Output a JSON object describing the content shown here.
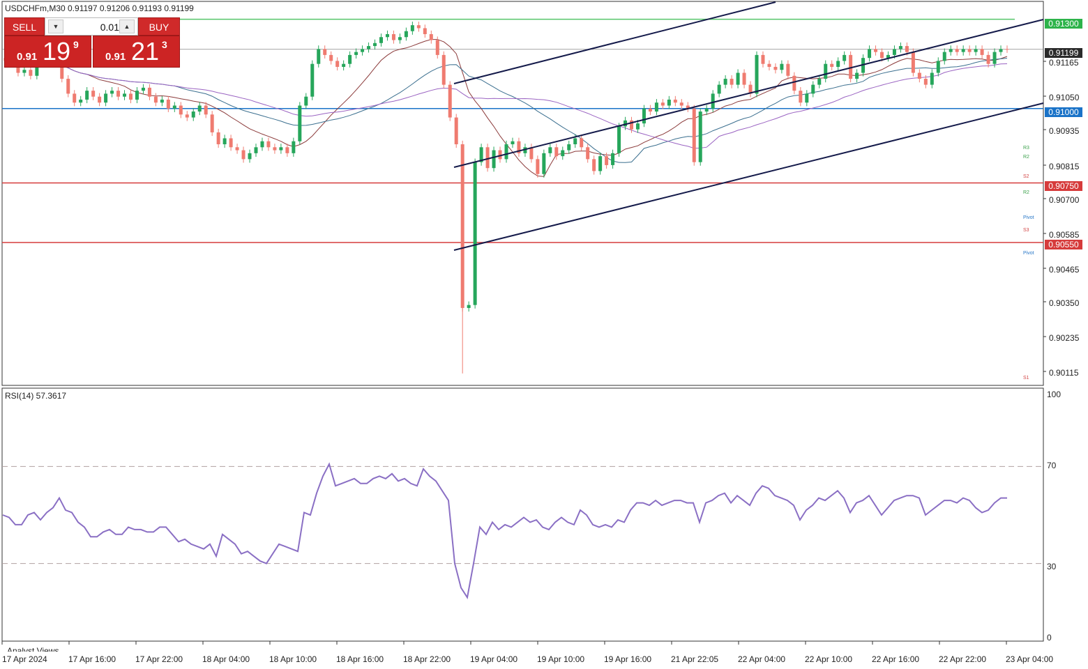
{
  "header": {
    "symbol_info": "USDCHFm,M30  0.91197 0.91206 0.91193 0.91199"
  },
  "trade_panel": {
    "sell_label": "SELL",
    "buy_label": "BUY",
    "lot_value": "0.01",
    "bid": {
      "prefix": "0.91",
      "big": "19",
      "sup": "9"
    },
    "ask": {
      "prefix": "0.91",
      "big": "21",
      "sup": "3"
    }
  },
  "price_tags": [
    {
      "label": "0.91300",
      "price": 0.913,
      "color": "#2db34a"
    },
    {
      "label": "0.91199",
      "price": 0.91199,
      "color": "#2a2a2a"
    },
    {
      "label": "0.91000",
      "price": 0.91,
      "color": "#1a73c8"
    },
    {
      "label": "0.90750",
      "price": 0.9075,
      "color": "#d63b3b"
    },
    {
      "label": "0.90550",
      "price": 0.9055,
      "color": "#d63b3b"
    }
  ],
  "price_axis_labels": [
    "0.91165",
    "0.91050",
    "0.90935",
    "0.90815",
    "0.90700",
    "0.90585",
    "0.90465",
    "0.90350",
    "0.90235",
    "0.90115"
  ],
  "pivot_labels": [
    {
      "text": "R3",
      "color": "#3aa04a"
    },
    {
      "text": "R2",
      "color": "#3aa04a"
    },
    {
      "text": "S2",
      "color": "#d24444"
    },
    {
      "text": "R2",
      "color": "#3aa04a"
    },
    {
      "text": "Pivot",
      "color": "#2a78c8"
    },
    {
      "text": "S3",
      "color": "#d24444"
    },
    {
      "text": "Pivot",
      "color": "#2a78c8"
    },
    {
      "text": "S1",
      "color": "#d24444"
    }
  ],
  "rsi": {
    "label": "RSI(14) 57.3617",
    "levels": [
      "100",
      "70",
      "30",
      "0"
    ]
  },
  "time_axis": [
    "17 Apr 2024",
    "17 Apr 16:00",
    "17 Apr 22:00",
    "18 Apr 04:00",
    "18 Apr 10:00",
    "18 Apr 16:00",
    "18 Apr 22:00",
    "19 Apr 04:00",
    "19 Apr 10:00",
    "19 Apr 16:00",
    "21 Apr 22:05",
    "22 Apr 04:00",
    "22 Apr 10:00",
    "22 Apr 16:00",
    "22 Apr 22:00",
    "23 Apr 04:00"
  ],
  "footer_text": "Analyst Views",
  "colors": {
    "bull": "#26a65b",
    "bear": "#ef7b70",
    "rsi_line": "#8a6fc4",
    "channel": "#141a4a"
  },
  "chart_data": [
    {
      "type": "candlestick",
      "title": "USDCHFm,M30",
      "ylim": [
        0.9007,
        0.9136
      ],
      "horizontal_levels": [
        0.913,
        0.91199,
        0.91,
        0.9075,
        0.9055
      ],
      "closes": [
        0.9116,
        0.9115,
        0.9112,
        0.9113,
        0.9111,
        0.9115,
        0.912,
        0.9118,
        0.9115,
        0.911,
        0.9105,
        0.9102,
        0.9103,
        0.9106,
        0.9104,
        0.9102,
        0.9105,
        0.9106,
        0.9104,
        0.9105,
        0.9103,
        0.9106,
        0.9107,
        0.9104,
        0.9102,
        0.9103,
        0.91,
        0.9101,
        0.9098,
        0.9097,
        0.9099,
        0.9101,
        0.9098,
        0.9092,
        0.9088,
        0.909,
        0.9087,
        0.9086,
        0.9083,
        0.9085,
        0.9087,
        0.9089,
        0.9087,
        0.9086,
        0.9087,
        0.9085,
        0.9089,
        0.9101,
        0.9104,
        0.9115,
        0.912,
        0.9118,
        0.9116,
        0.9114,
        0.9115,
        0.9118,
        0.9119,
        0.912,
        0.9121,
        0.9122,
        0.9124,
        0.9125,
        0.9123,
        0.9124,
        0.9126,
        0.9128,
        0.9127,
        0.9125,
        0.9123,
        0.9118,
        0.9108,
        0.9097,
        0.9088,
        0.9033,
        0.9034,
        0.9082,
        0.9087,
        0.908,
        0.9086,
        0.9083,
        0.9088,
        0.9089,
        0.9085,
        0.9087,
        0.9083,
        0.9078,
        0.9085,
        0.9087,
        0.9084,
        0.9086,
        0.9088,
        0.909,
        0.9087,
        0.9083,
        0.9079,
        0.9084,
        0.9081,
        0.9085,
        0.9094,
        0.9096,
        0.9093,
        0.9095,
        0.91,
        0.9099,
        0.9102,
        0.9101,
        0.9103,
        0.9102,
        0.9101,
        0.91,
        0.9082,
        0.9099,
        0.91,
        0.9105,
        0.9108,
        0.911,
        0.9108,
        0.9112,
        0.9108,
        0.9105,
        0.9118,
        0.9115,
        0.9114,
        0.9113,
        0.9115,
        0.9111,
        0.9106,
        0.9102,
        0.9105,
        0.9108,
        0.911,
        0.9115,
        0.9114,
        0.9116,
        0.9118,
        0.911,
        0.9112,
        0.9117,
        0.912,
        0.9119,
        0.9117,
        0.9118,
        0.912,
        0.9121,
        0.9119,
        0.9112,
        0.911,
        0.9108,
        0.9112,
        0.9116,
        0.9119,
        0.912,
        0.9119,
        0.912,
        0.9119,
        0.912,
        0.9118,
        0.9115,
        0.9119,
        0.912,
        0.91199
      ]
    },
    {
      "type": "line",
      "title": "RSI(14) 57.3617",
      "ylim": [
        0,
        100
      ],
      "levels": [
        70,
        30
      ],
      "values": [
        50,
        49,
        46,
        46,
        50,
        51,
        48,
        51,
        53,
        57,
        52,
        51,
        47,
        45,
        41,
        41,
        43,
        44,
        42,
        42,
        45,
        44,
        44,
        43,
        43,
        45,
        45,
        42,
        39,
        40,
        38,
        37,
        36,
        38,
        33,
        42,
        40,
        38,
        34,
        35,
        33,
        31,
        30,
        34,
        38,
        37,
        36,
        35,
        51,
        50,
        59,
        66,
        71,
        62,
        63,
        64,
        65,
        63,
        63,
        65,
        66,
        65,
        67,
        64,
        65,
        63,
        62,
        69,
        66,
        64,
        60,
        56,
        30,
        20,
        16,
        30,
        45,
        42,
        47,
        44,
        46,
        45,
        47,
        49,
        47,
        48,
        45,
        44,
        47,
        49,
        47,
        46,
        52,
        50,
        46,
        45,
        46,
        45,
        48,
        47,
        52,
        55,
        55,
        54,
        56,
        54,
        55,
        56,
        56,
        55,
        55,
        47,
        55,
        56,
        58,
        59,
        55,
        58,
        56,
        54,
        59,
        62,
        61,
        58,
        57,
        56,
        54,
        48,
        52,
        54,
        57,
        56,
        58,
        60,
        57,
        51,
        55,
        56,
        58,
        54,
        50,
        53,
        56,
        57,
        58,
        58,
        57,
        50,
        52,
        54,
        56,
        56,
        55,
        57,
        56,
        53,
        51,
        52,
        55,
        57,
        57
      ]
    }
  ]
}
